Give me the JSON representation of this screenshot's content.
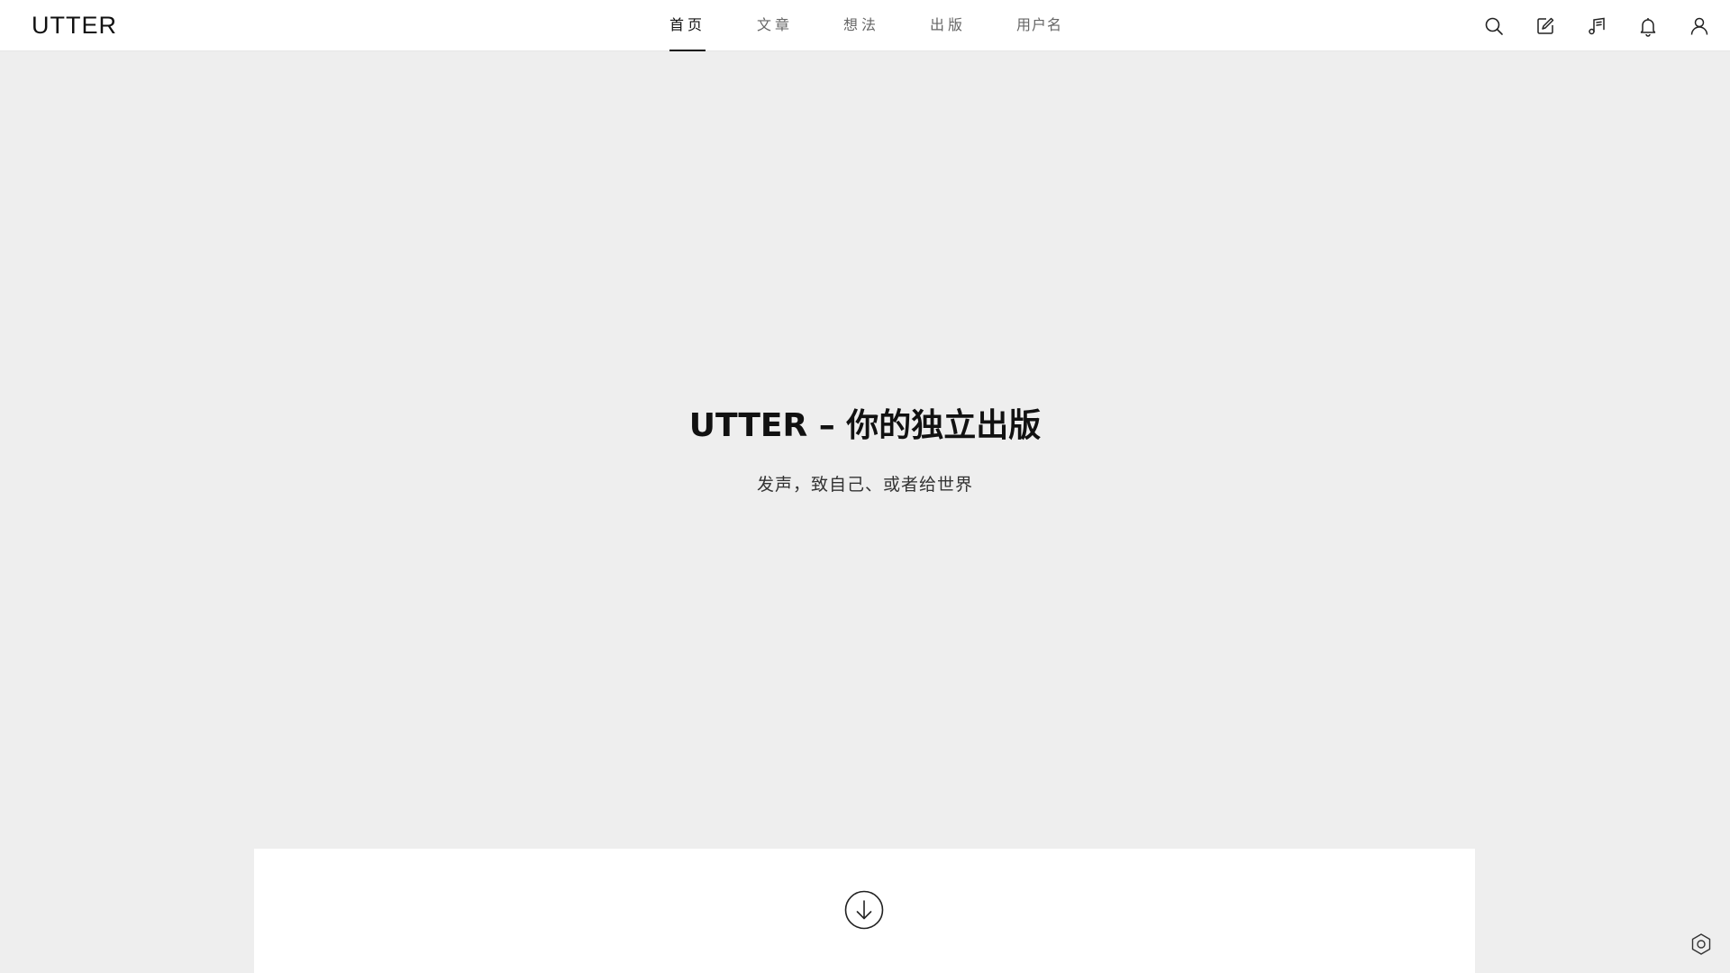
{
  "header": {
    "logo": "UTTER",
    "nav": [
      {
        "label": "首页",
        "active": true
      },
      {
        "label": "文章",
        "active": false
      },
      {
        "label": "想法",
        "active": false
      },
      {
        "label": "出版",
        "active": false
      },
      {
        "label": "用户名",
        "active": false
      }
    ],
    "tools": [
      "search-icon",
      "edit-icon",
      "music-list-icon",
      "bell-icon",
      "user-icon"
    ]
  },
  "hero": {
    "title": "UTTER – 你的独立出版",
    "subtitle": "发声，致自己、或者给世界"
  },
  "content": {
    "scroll_icon": "arrow-down-circle-icon"
  },
  "floating": {
    "settings_icon": "hexagon-settings-icon"
  },
  "colors": {
    "background": "#eeeeee",
    "header": "#ffffff",
    "card": "#ffffff",
    "text": "#111111",
    "muted": "#666666"
  }
}
